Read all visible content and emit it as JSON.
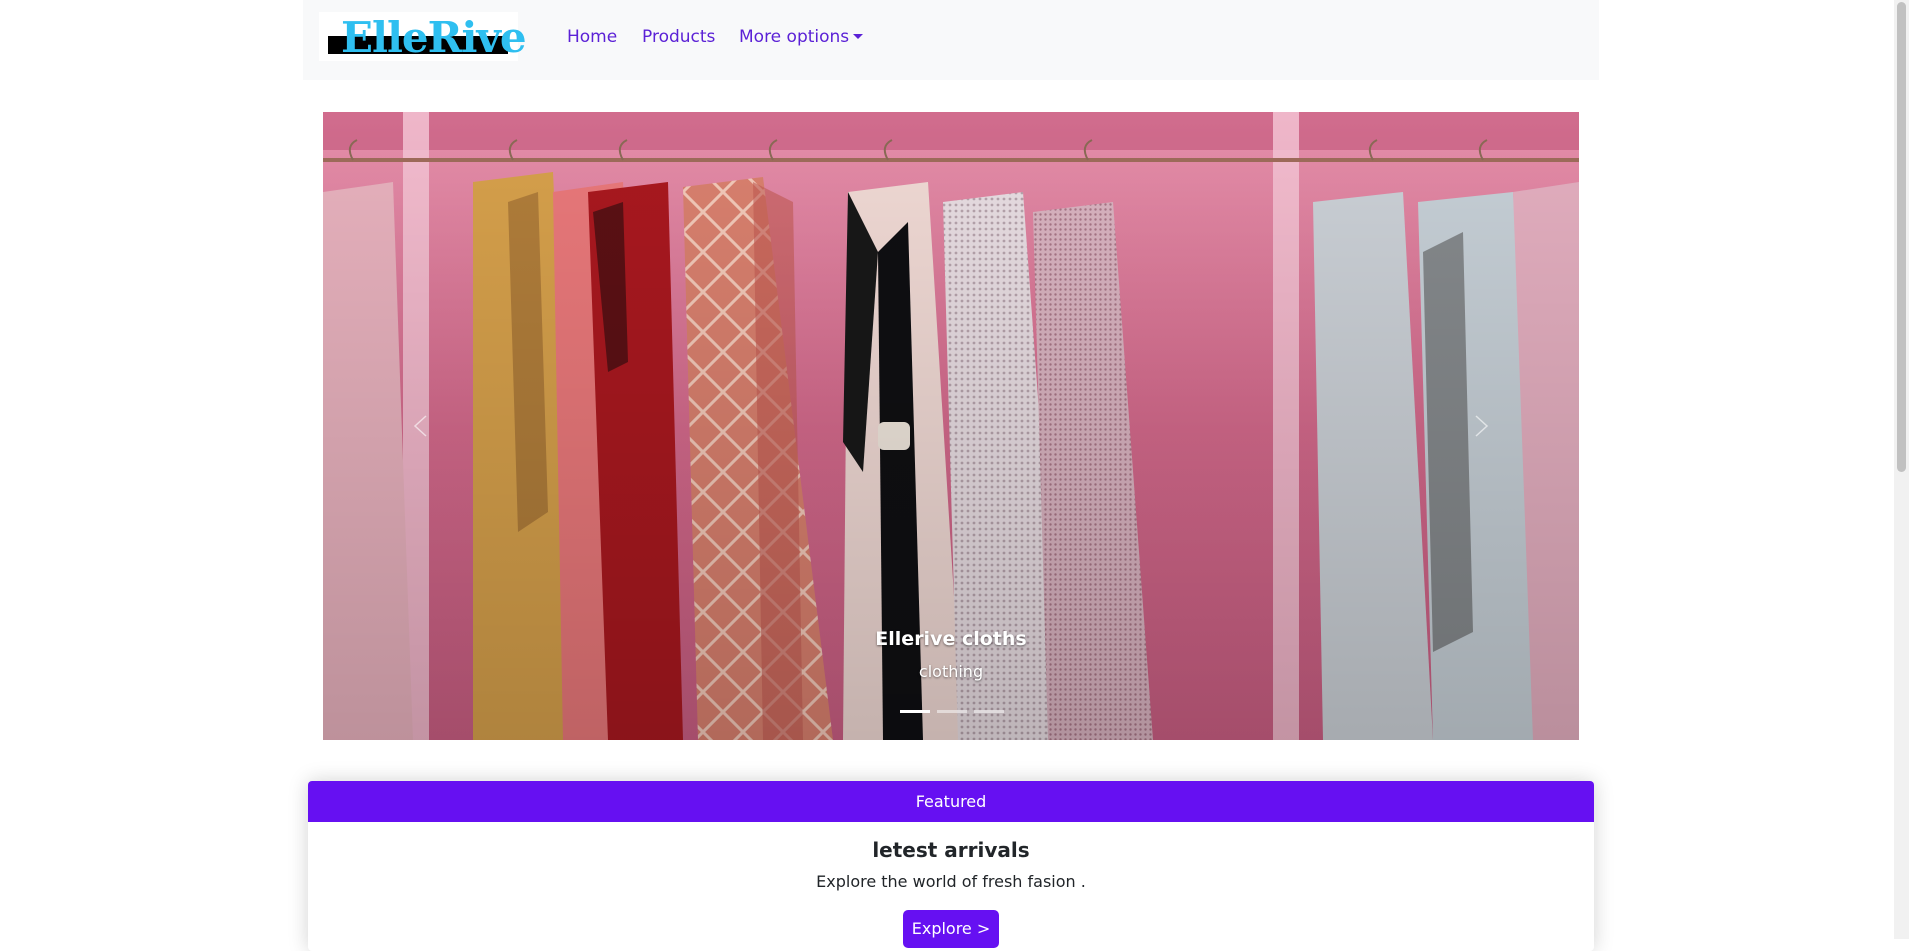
{
  "navbar": {
    "brand": "ElleRive",
    "links": [
      {
        "label": "Home"
      },
      {
        "label": "Products"
      },
      {
        "label": "More options"
      }
    ]
  },
  "carousel": {
    "slides_total": 3,
    "active_slide": 1,
    "caption": {
      "title": "Ellerive cloths",
      "subtitle": "clothing"
    },
    "prev_icon": "chevron-left-icon",
    "next_icon": "chevron-right-icon"
  },
  "featured": {
    "header": "Featured",
    "title": "letest arrivals",
    "text": "Explore the world of fresh fasion .",
    "button": "Explore >"
  },
  "colors": {
    "accent": "#6610f2",
    "link": "#5b21d6",
    "navbar_bg": "#f8f9fa",
    "logo_text": "#2fbff0",
    "carousel_bg": "#d26b8d"
  }
}
